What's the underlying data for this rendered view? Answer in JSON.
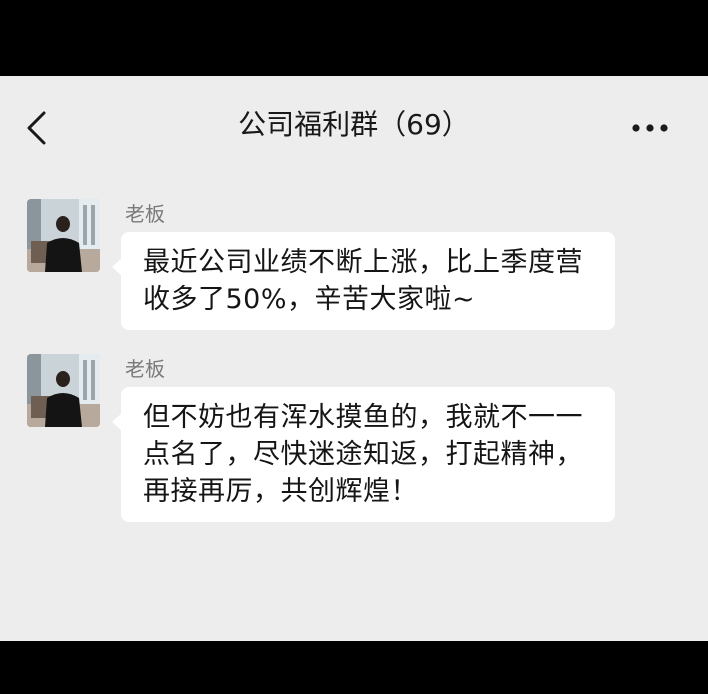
{
  "chat": {
    "title": "公司福利群（69）",
    "back_icon": "chevron-left-icon",
    "more_icon": "more-horizontal-icon"
  },
  "messages": [
    {
      "sender": "老板",
      "text": "最近公司业绩不断上涨，比上季度营收多了50%，辛苦大家啦~"
    },
    {
      "sender": "老板",
      "text": "但不妨也有浑水摸鱼的，我就不一一点名了，尽快迷途知返，打起精神，再接再厉，共创辉煌！"
    }
  ],
  "colors": {
    "background": "#ededed",
    "bubble": "#ffffff",
    "text": "#151515",
    "sender_name": "#7a7a7a"
  }
}
